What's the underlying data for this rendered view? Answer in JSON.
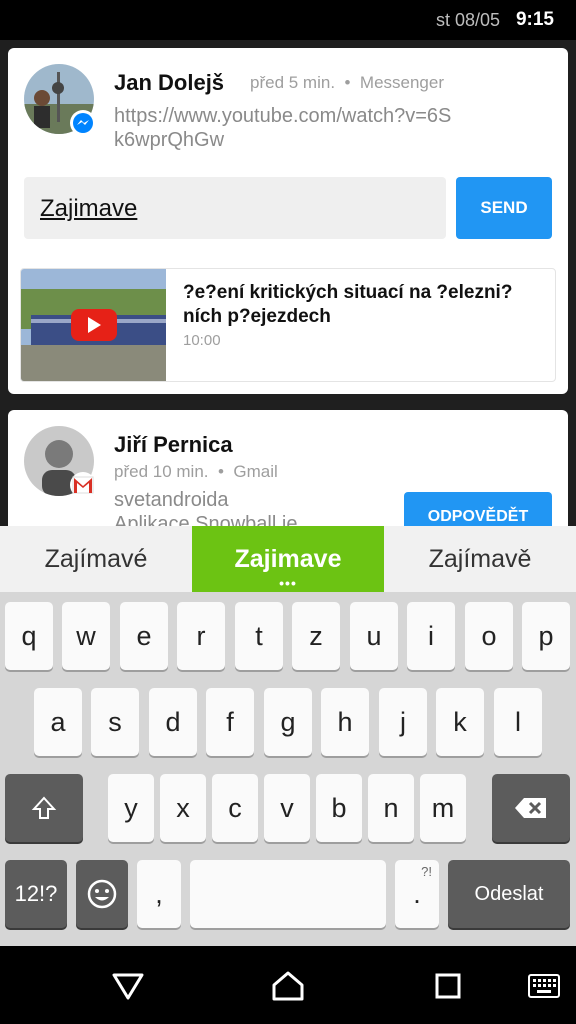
{
  "status_bar": {
    "date": "st 08/05",
    "time": "9:15"
  },
  "notifications": [
    {
      "sender": "Jan Dolejš",
      "time_ago": "před 5 min.",
      "app": "Messenger",
      "message": "https://www.youtube.com/watch?v=6Sk6wprQhGw",
      "reply_value": "Zajimave",
      "send_label": "SEND",
      "video": {
        "title": "?e?ení kritických situací na ?elezni?ních p?ejezdech",
        "duration": "10:00"
      }
    },
    {
      "sender": "Jiří Pernica",
      "time_ago": "před 10 min.",
      "app": "Gmail",
      "line1": "svetandroida",
      "line2": "Aplikace Snowball je",
      "reply_label": "ODPOVĚDĚT"
    }
  ],
  "suggestions": [
    "Zajímavé",
    "Zajimave",
    "Zajímavě"
  ],
  "suggestion_dots": "•••",
  "keyboard": {
    "row1": [
      "q",
      "w",
      "e",
      "r",
      "t",
      "z",
      "u",
      "i",
      "o",
      "p"
    ],
    "row2": [
      "a",
      "s",
      "d",
      "f",
      "g",
      "h",
      "j",
      "k",
      "l"
    ],
    "row3": [
      "y",
      "x",
      "c",
      "v",
      "b",
      "n",
      "m"
    ],
    "symbols_label": "12!?",
    "comma": ",",
    "period": ".",
    "period_hint": "?!",
    "enter_label": "Odeslat"
  },
  "colors": {
    "accent": "#2196f3",
    "suggestion_highlight": "#6cc313",
    "messenger": "#0084ff",
    "gmail": "#d93025"
  },
  "icons": [
    "shift-icon",
    "backspace-icon",
    "emoji-icon",
    "back-icon",
    "home-icon",
    "recents-icon",
    "keyboard-switch-icon",
    "messenger-icon",
    "gmail-icon",
    "play-icon"
  ]
}
